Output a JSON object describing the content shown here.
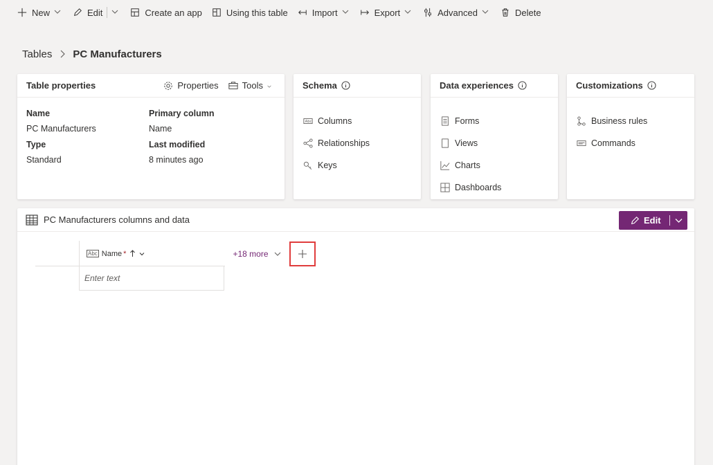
{
  "toolbar": {
    "new_label": "New",
    "edit_label": "Edit",
    "create_app_label": "Create an app",
    "using_table_label": "Using this table",
    "import_label": "Import",
    "export_label": "Export",
    "advanced_label": "Advanced",
    "delete_label": "Delete"
  },
  "breadcrumb": {
    "parent": "Tables",
    "current": "PC Manufacturers"
  },
  "table_properties": {
    "title": "Table properties",
    "properties_label": "Properties",
    "tools_label": "Tools",
    "fields": {
      "name_label": "Name",
      "name_value": "PC Manufacturers",
      "type_label": "Type",
      "type_value": "Standard",
      "primary_label": "Primary column",
      "primary_value": "Name",
      "modified_label": "Last modified",
      "modified_value": "8 minutes ago"
    }
  },
  "schema": {
    "title": "Schema",
    "items": [
      "Columns",
      "Relationships",
      "Keys"
    ]
  },
  "data_experiences": {
    "title": "Data experiences",
    "items": [
      "Forms",
      "Views",
      "Charts",
      "Dashboards"
    ]
  },
  "customizations": {
    "title": "Customizations",
    "items": [
      "Business rules",
      "Commands"
    ]
  },
  "data_section": {
    "title": "PC Manufacturers columns and data",
    "edit_label": "Edit",
    "column_name": "Name",
    "required_mark": "*",
    "more_columns": "+18 more",
    "cell_placeholder": "Enter text"
  },
  "colors": {
    "accent": "#742774",
    "highlight_box": "#e03c3c"
  }
}
